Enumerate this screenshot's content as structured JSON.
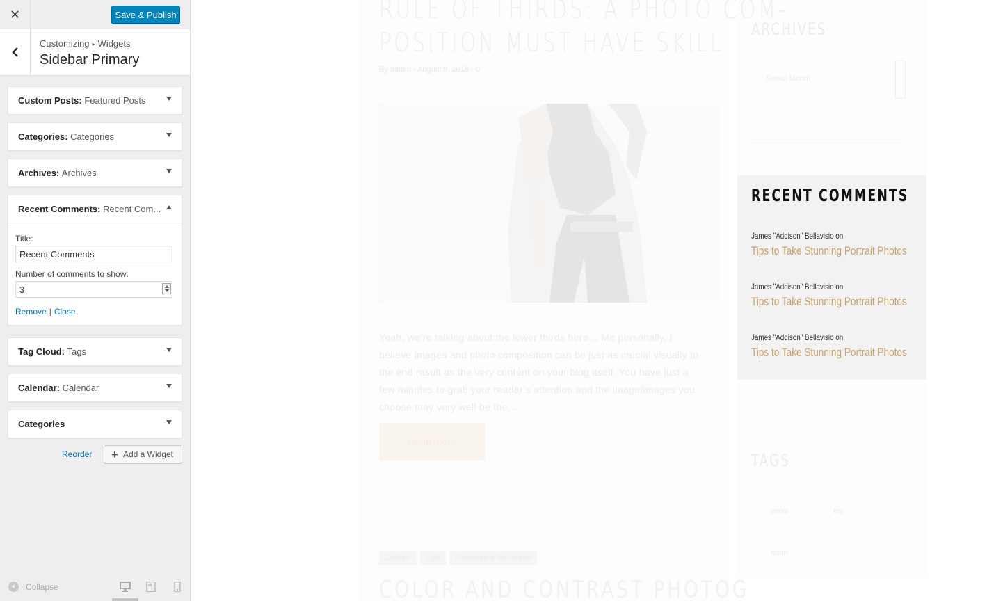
{
  "customizer": {
    "publish_label": "Save & Publish",
    "breadcrumb": {
      "root": "Customizing",
      "separator": "▸",
      "current": "Widgets"
    },
    "section_title": "Sidebar Primary",
    "widgets": [
      {
        "type": "Custom Posts",
        "title": "Featured Posts",
        "expanded": false
      },
      {
        "type": "Categories",
        "title": "Categories",
        "expanded": false
      },
      {
        "type": "Archives",
        "title": "Archives",
        "expanded": false
      },
      {
        "type": "Recent Comments",
        "title": "Recent Com...",
        "expanded": true,
        "form": {
          "title_label": "Title:",
          "title_value": "Recent Comments",
          "number_label": "Number of comments to show:",
          "number_value": "3",
          "remove_label": "Remove",
          "separator": "|",
          "close_label": "Close"
        }
      },
      {
        "type": "Tag Cloud",
        "title": "Tags",
        "expanded": false
      },
      {
        "type": "Calendar",
        "title": "Calendar",
        "expanded": false
      },
      {
        "type": "Categories",
        "title": "",
        "expanded": false
      }
    ],
    "reorder_label": "Reorder",
    "add_widget_label": "Add a Widget",
    "collapse_label": "Collapse",
    "active_device": "desktop",
    "colors": {
      "primary_button": "#0085ba",
      "link": "#0073aa",
      "panel_bg": "#eeeeee"
    }
  },
  "preview": {
    "post": {
      "title_line1": "Rule of Thirds: A Photo Com-",
      "title_line2": "position Must Have Skill",
      "meta": "By admin - August 8, 2018 - 0",
      "excerpt": "Yeah, we’re talking about the lower thirds here… Me personally, I believe images and photo composition can be just as crucial visually to the end result as the very content on your blog itself. You have just a few minutes to grab your reader’s attention and the image/images you choose may very well be the…",
      "read_more": "Read more"
    },
    "post2": {
      "chips": [
        "Contrast",
        "Light",
        "Photography Techniques"
      ],
      "title": "Color and Contrast Photog"
    },
    "sidebar": {
      "archives_title": "Archives",
      "archives_select": "Select Month",
      "recent_comments": {
        "title": "Recent Comments",
        "items": [
          {
            "author": "James \"Addison\" Bellavisio on",
            "post": "Tips to Take Stunning Portrait Photos"
          },
          {
            "author": "James \"Addison\" Bellavisio on",
            "post": "Tips to Take Stunning Portrait Photos"
          },
          {
            "author": "James \"Addison\" Bellavisio on",
            "post": "Tips to Take Stunning Portrait Photos"
          }
        ]
      },
      "tags_title": "Tags",
      "tag_words": [
        "snow",
        "toy",
        "team"
      ],
      "accent_color": "#c9a36c"
    }
  }
}
